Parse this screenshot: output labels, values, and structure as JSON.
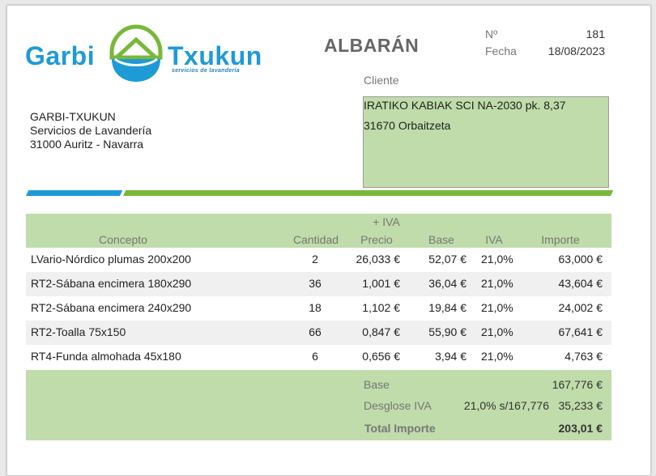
{
  "brand": {
    "word_left": "Garbi",
    "word_right": "Txukun",
    "tagline": "servicios de lavandería",
    "colors": {
      "blue": "#1e9bd7",
      "green": "#78b83a",
      "panel_green": "#bfdcaa"
    }
  },
  "doc": {
    "title": "ALBARÁN",
    "number_label": "Nº",
    "number": "181",
    "date_label": "Fecha",
    "date": "18/08/2023"
  },
  "issuer": {
    "name": "GARBI-TXUKUN",
    "line1": "Servicios de Lavandería",
    "line2": "31000 Auritz - Navarra"
  },
  "client": {
    "label": "Cliente",
    "line1": "IRATIKO KABIAK SCI NA-2030 pk. 8,37",
    "line2": "31670 Orbaitzeta"
  },
  "table": {
    "headers": {
      "concepto": "Concepto",
      "cantidad": "Cantidad",
      "iva_note": "+ IVA",
      "precio": "Precio",
      "base": "Base",
      "iva": "IVA",
      "importe": "Importe"
    },
    "rows": [
      {
        "concepto": "LVario-Nórdico plumas 200x200",
        "cantidad": "2",
        "precio": "26,033 €",
        "base": "52,07 €",
        "iva": "21,0%",
        "importe": "63,000 €"
      },
      {
        "concepto": "RT2-Sábana encimera 180x290",
        "cantidad": "36",
        "precio": "1,001 €",
        "base": "36,04 €",
        "iva": "21,0%",
        "importe": "43,604 €"
      },
      {
        "concepto": "RT2-Sábana encimera 240x290",
        "cantidad": "18",
        "precio": "1,102 €",
        "base": "19,84 €",
        "iva": "21,0%",
        "importe": "24,002 €"
      },
      {
        "concepto": "RT2-Toalla 75x150",
        "cantidad": "66",
        "precio": "0,847 €",
        "base": "55,90 €",
        "iva": "21,0%",
        "importe": "67,641 €"
      },
      {
        "concepto": "RT4-Funda almohada 45x180",
        "cantidad": "6",
        "precio": "0,656 €",
        "base": "3,94 €",
        "iva": "21,0%",
        "importe": "4,763 €"
      }
    ]
  },
  "totals": {
    "base_label": "Base",
    "base_value": "167,776 €",
    "desglose_label": "Desglose IVA",
    "desglose_detail": "21,0% s/167,776",
    "desglose_value": "35,233 €",
    "total_label": "Total Importe",
    "total_value": "203,01 €"
  }
}
